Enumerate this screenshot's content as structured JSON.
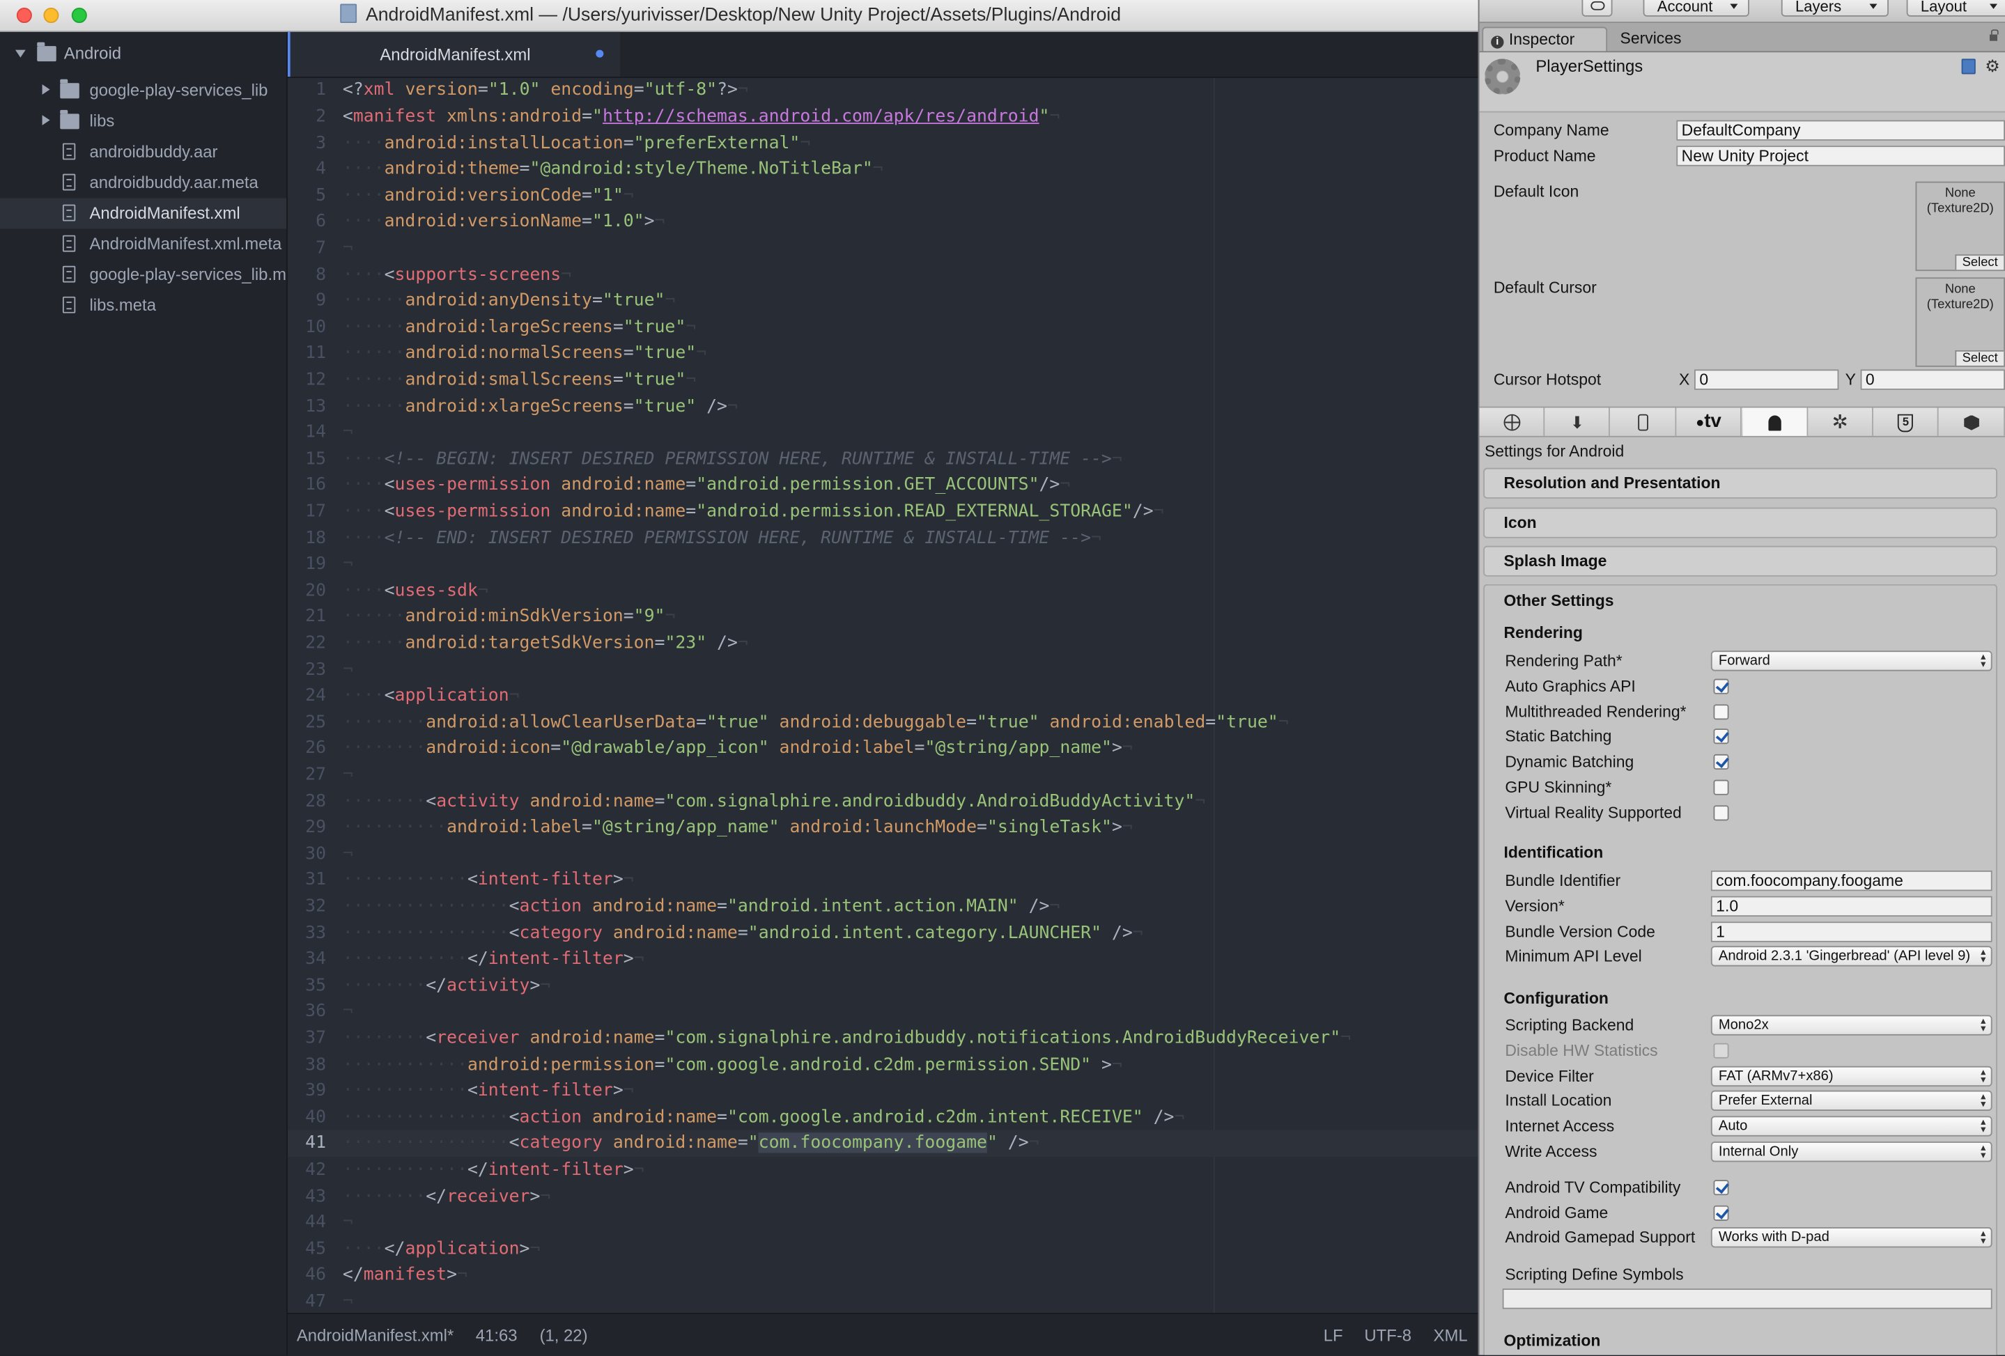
{
  "window": {
    "title": "AndroidManifest.xml — /Users/yurivisser/Desktop/New Unity Project/Assets/Plugins/Android"
  },
  "tree": {
    "root": "Android",
    "items": [
      {
        "label": "google-play-services_lib",
        "kind": "folder",
        "icon": "folder-icon"
      },
      {
        "label": "libs",
        "kind": "folder",
        "icon": "folder-icon"
      },
      {
        "label": "androidbuddy.aar",
        "kind": "file",
        "icon": "file-icon"
      },
      {
        "label": "androidbuddy.aar.meta",
        "kind": "file",
        "icon": "file-icon"
      },
      {
        "label": "AndroidManifest.xml",
        "kind": "file",
        "icon": "file-icon",
        "selected": true
      },
      {
        "label": "AndroidManifest.xml.meta",
        "kind": "file",
        "icon": "file-icon"
      },
      {
        "label": "google-play-services_lib.meta",
        "kind": "file",
        "icon": "file-icon"
      },
      {
        "label": "libs.meta",
        "kind": "file",
        "icon": "file-icon"
      }
    ]
  },
  "editor": {
    "tab_label": "AndroidManifest.xml",
    "current_line": 41,
    "lines": [
      [
        [
          "p",
          "<?"
        ],
        [
          "n",
          "xml"
        ],
        [
          "a",
          " version"
        ],
        [
          "p",
          "="
        ],
        [
          "s",
          "\"1.0\""
        ],
        [
          "a",
          " encoding"
        ],
        [
          "p",
          "="
        ],
        [
          "s",
          "\"utf-8\""
        ],
        [
          "p",
          "?>"
        ]
      ],
      [
        [
          "p",
          "<"
        ],
        [
          "n",
          "manifest"
        ],
        [
          "a",
          " xmlns:android"
        ],
        [
          "p",
          "="
        ],
        [
          "s",
          "\""
        ],
        [
          "u",
          "http://schemas.android.com/apk/res/android"
        ],
        [
          "s",
          "\""
        ]
      ],
      [
        [
          "w",
          "····"
        ],
        [
          "a",
          "android:installLocation"
        ],
        [
          "p",
          "="
        ],
        [
          "s",
          "\"preferExternal\""
        ]
      ],
      [
        [
          "w",
          "····"
        ],
        [
          "a",
          "android:theme"
        ],
        [
          "p",
          "="
        ],
        [
          "s",
          "\"@android:style/Theme.NoTitleBar\""
        ]
      ],
      [
        [
          "w",
          "····"
        ],
        [
          "a",
          "android:versionCode"
        ],
        [
          "p",
          "="
        ],
        [
          "s",
          "\"1\""
        ]
      ],
      [
        [
          "w",
          "····"
        ],
        [
          "a",
          "android:versionName"
        ],
        [
          "p",
          "="
        ],
        [
          "s",
          "\"1.0\""
        ],
        [
          "p",
          ">"
        ]
      ],
      [],
      [
        [
          "w",
          "····"
        ],
        [
          "p",
          "<"
        ],
        [
          "n",
          "supports-screens"
        ]
      ],
      [
        [
          "w",
          "······"
        ],
        [
          "a",
          "android:anyDensity"
        ],
        [
          "p",
          "="
        ],
        [
          "s",
          "\"true\""
        ]
      ],
      [
        [
          "w",
          "······"
        ],
        [
          "a",
          "android:largeScreens"
        ],
        [
          "p",
          "="
        ],
        [
          "s",
          "\"true\""
        ]
      ],
      [
        [
          "w",
          "······"
        ],
        [
          "a",
          "android:normalScreens"
        ],
        [
          "p",
          "="
        ],
        [
          "s",
          "\"true\""
        ]
      ],
      [
        [
          "w",
          "······"
        ],
        [
          "a",
          "android:smallScreens"
        ],
        [
          "p",
          "="
        ],
        [
          "s",
          "\"true\""
        ]
      ],
      [
        [
          "w",
          "······"
        ],
        [
          "a",
          "android:xlargeScreens"
        ],
        [
          "p",
          "="
        ],
        [
          "s",
          "\"true\""
        ],
        [
          "p",
          " />"
        ]
      ],
      [],
      [
        [
          "w",
          "····"
        ],
        [
          "c",
          "<!-- BEGIN: INSERT DESIRED PERMISSION HERE, RUNTIME & INSTALL-TIME -->"
        ]
      ],
      [
        [
          "w",
          "····"
        ],
        [
          "p",
          "<"
        ],
        [
          "n",
          "uses-permission"
        ],
        [
          "a",
          " android:name"
        ],
        [
          "p",
          "="
        ],
        [
          "s",
          "\"android.permission.GET_ACCOUNTS\""
        ],
        [
          "p",
          "/>"
        ]
      ],
      [
        [
          "w",
          "····"
        ],
        [
          "p",
          "<"
        ],
        [
          "n",
          "uses-permission"
        ],
        [
          "a",
          " android:name"
        ],
        [
          "p",
          "="
        ],
        [
          "s",
          "\"android.permission.READ_EXTERNAL_STORAGE\""
        ],
        [
          "p",
          "/>"
        ]
      ],
      [
        [
          "w",
          "····"
        ],
        [
          "c",
          "<!-- END: INSERT DESIRED PERMISSION HERE, RUNTIME & INSTALL-TIME -->"
        ]
      ],
      [],
      [
        [
          "w",
          "····"
        ],
        [
          "p",
          "<"
        ],
        [
          "n",
          "uses-sdk"
        ]
      ],
      [
        [
          "w",
          "······"
        ],
        [
          "a",
          "android:minSdkVersion"
        ],
        [
          "p",
          "="
        ],
        [
          "s",
          "\"9\""
        ]
      ],
      [
        [
          "w",
          "······"
        ],
        [
          "a",
          "android:targetSdkVersion"
        ],
        [
          "p",
          "="
        ],
        [
          "s",
          "\"23\""
        ],
        [
          "p",
          " />"
        ]
      ],
      [],
      [
        [
          "w",
          "····"
        ],
        [
          "p",
          "<"
        ],
        [
          "n",
          "application"
        ]
      ],
      [
        [
          "w",
          "········"
        ],
        [
          "a",
          "android:allowClearUserData"
        ],
        [
          "p",
          "="
        ],
        [
          "s",
          "\"true\""
        ],
        [
          "a",
          " android:debuggable"
        ],
        [
          "p",
          "="
        ],
        [
          "s",
          "\"true\""
        ],
        [
          "a",
          " android:enabled"
        ],
        [
          "p",
          "="
        ],
        [
          "s",
          "\"true\""
        ]
      ],
      [
        [
          "w",
          "········"
        ],
        [
          "a",
          "android:icon"
        ],
        [
          "p",
          "="
        ],
        [
          "s",
          "\"@drawable/app_icon\""
        ],
        [
          "a",
          " android:label"
        ],
        [
          "p",
          "="
        ],
        [
          "s",
          "\"@string/app_name\""
        ],
        [
          "p",
          ">"
        ]
      ],
      [],
      [
        [
          "w",
          "········"
        ],
        [
          "p",
          "<"
        ],
        [
          "n",
          "activity"
        ],
        [
          "a",
          " android:name"
        ],
        [
          "p",
          "="
        ],
        [
          "s",
          "\"com.signalphire.androidbuddy.AndroidBuddyActivity\""
        ]
      ],
      [
        [
          "w",
          "··········"
        ],
        [
          "a",
          "android:label"
        ],
        [
          "p",
          "="
        ],
        [
          "s",
          "\"@string/app_name\""
        ],
        [
          "a",
          " android:launchMode"
        ],
        [
          "p",
          "="
        ],
        [
          "s",
          "\"singleTask\""
        ],
        [
          "p",
          ">"
        ]
      ],
      [],
      [
        [
          "w",
          "············"
        ],
        [
          "p",
          "<"
        ],
        [
          "n",
          "intent-filter"
        ],
        [
          "p",
          ">"
        ]
      ],
      [
        [
          "w",
          "················"
        ],
        [
          "p",
          "<"
        ],
        [
          "n",
          "action"
        ],
        [
          "a",
          " android:name"
        ],
        [
          "p",
          "="
        ],
        [
          "s",
          "\"android.intent.action.MAIN\""
        ],
        [
          "p",
          " />"
        ]
      ],
      [
        [
          "w",
          "················"
        ],
        [
          "p",
          "<"
        ],
        [
          "n",
          "category"
        ],
        [
          "a",
          " android:name"
        ],
        [
          "p",
          "="
        ],
        [
          "s",
          "\"android.intent.category.LAUNCHER\""
        ],
        [
          "p",
          " />"
        ]
      ],
      [
        [
          "w",
          "············"
        ],
        [
          "p",
          "</"
        ],
        [
          "n",
          "intent-filter"
        ],
        [
          "p",
          ">"
        ]
      ],
      [
        [
          "w",
          "········"
        ],
        [
          "p",
          "</"
        ],
        [
          "n",
          "activity"
        ],
        [
          "p",
          ">"
        ]
      ],
      [],
      [
        [
          "w",
          "········"
        ],
        [
          "p",
          "<"
        ],
        [
          "n",
          "receiver"
        ],
        [
          "a",
          " android:name"
        ],
        [
          "p",
          "="
        ],
        [
          "s",
          "\"com.signalphire.androidbuddy.notifications.AndroidBuddyReceiver\""
        ]
      ],
      [
        [
          "w",
          "············"
        ],
        [
          "a",
          "android:permission"
        ],
        [
          "p",
          "="
        ],
        [
          "s",
          "\"com.google.android.c2dm.permission.SEND\""
        ],
        [
          "p",
          " >"
        ]
      ],
      [
        [
          "w",
          "············"
        ],
        [
          "p",
          "<"
        ],
        [
          "n",
          "intent-filter"
        ],
        [
          "p",
          ">"
        ]
      ],
      [
        [
          "w",
          "················"
        ],
        [
          "p",
          "<"
        ],
        [
          "n",
          "action"
        ],
        [
          "a",
          " android:name"
        ],
        [
          "p",
          "="
        ],
        [
          "s",
          "\"com.google.android.c2dm.intent.RECEIVE\""
        ],
        [
          "p",
          " />"
        ]
      ],
      [
        [
          "w",
          "················"
        ],
        [
          "p",
          "<"
        ],
        [
          "n",
          "category"
        ],
        [
          "a",
          " android:name"
        ],
        [
          "p",
          "="
        ],
        [
          "s",
          "\""
        ],
        [
          "h",
          "com.foocompany.foogame"
        ],
        [
          "s",
          "\""
        ],
        [
          "p",
          " />"
        ]
      ],
      [
        [
          "w",
          "············"
        ],
        [
          "p",
          "</"
        ],
        [
          "n",
          "intent-filter"
        ],
        [
          "p",
          ">"
        ]
      ],
      [
        [
          "w",
          "········"
        ],
        [
          "p",
          "</"
        ],
        [
          "n",
          "receiver"
        ],
        [
          "p",
          ">"
        ]
      ],
      [],
      [
        [
          "w",
          "····"
        ],
        [
          "p",
          "</"
        ],
        [
          "n",
          "application"
        ],
        [
          "p",
          ">"
        ]
      ],
      [
        [
          "p",
          "</"
        ],
        [
          "n",
          "manifest"
        ],
        [
          "p",
          ">"
        ]
      ],
      []
    ]
  },
  "status": {
    "file": "AndroidManifest.xml*",
    "position": "41:63",
    "selection": "(1, 22)",
    "line_ending": "LF",
    "encoding": "UTF-8",
    "grammar": "XML"
  },
  "unity": {
    "toolbar": {
      "account": "Account",
      "layers": "Layers",
      "layout": "Layout"
    },
    "tabs": {
      "inspector": "Inspector",
      "services": "Services"
    },
    "header_title": "PlayerSettings",
    "company_label": "Company Name",
    "company_value": "DefaultCompany",
    "product_label": "Product Name",
    "product_value": "New Unity Project",
    "default_icon_label": "Default Icon",
    "default_cursor_label": "Default Cursor",
    "tex_none": "None\n(Texture2D)",
    "tex_select": "Select",
    "hotspot_label": "Cursor Hotspot",
    "hotspot_x_label": "X",
    "hotspot_x": "0",
    "hotspot_y_label": "Y",
    "hotspot_y": "0",
    "platforms": [
      {
        "icon": "globe-icon"
      },
      {
        "icon": "download-icon"
      },
      {
        "icon": "phone-icon"
      },
      {
        "icon": "appletv-icon",
        "label": "tv"
      },
      {
        "icon": "android-icon",
        "active": true
      },
      {
        "icon": "tizen-icon"
      },
      {
        "icon": "html5-icon"
      },
      {
        "icon": "package-icon"
      }
    ],
    "settings_for": "Settings for Android",
    "sections": [
      "Resolution and Presentation",
      "Icon",
      "Splash Image"
    ],
    "other_settings": "Other Settings",
    "rendering": {
      "title": "Rendering",
      "path_label": "Rendering Path*",
      "path_value": "Forward",
      "checks": [
        {
          "label": "Auto Graphics API",
          "on": true
        },
        {
          "label": "Multithreaded Rendering*",
          "on": false
        },
        {
          "label": "Static Batching",
          "on": true
        },
        {
          "label": "Dynamic Batching",
          "on": true
        },
        {
          "label": "GPU Skinning*",
          "on": false
        },
        {
          "label": "Virtual Reality Supported",
          "on": false
        }
      ]
    },
    "identification": {
      "title": "Identification",
      "bundle_id_label": "Bundle Identifier",
      "bundle_id": "com.foocompany.foogame",
      "version_label": "Version*",
      "version": "1.0",
      "bundle_code_label": "Bundle Version Code",
      "bundle_code": "1",
      "min_api_label": "Minimum API Level",
      "min_api": "Android 2.3.1 'Gingerbread' (API level 9)"
    },
    "configuration": {
      "title": "Configuration",
      "scripting_backend_label": "Scripting Backend",
      "scripting_backend": "Mono2x",
      "disable_hw_label": "Disable HW Statistics",
      "device_filter_label": "Device Filter",
      "device_filter": "FAT (ARMv7+x86)",
      "install_location_label": "Install Location",
      "install_location": "Prefer External",
      "internet_access_label": "Internet Access",
      "internet_access": "Auto",
      "write_access_label": "Write Access",
      "write_access": "Internal Only",
      "tv_compat_label": "Android TV Compatibility",
      "tv_compat": true,
      "android_game_label": "Android Game",
      "android_game": true,
      "gamepad_label": "Android Gamepad Support",
      "gamepad": "Works with D-pad",
      "define_symbols_label": "Scripting Define Symbols",
      "define_symbols": ""
    },
    "optimization_title": "Optimization"
  }
}
